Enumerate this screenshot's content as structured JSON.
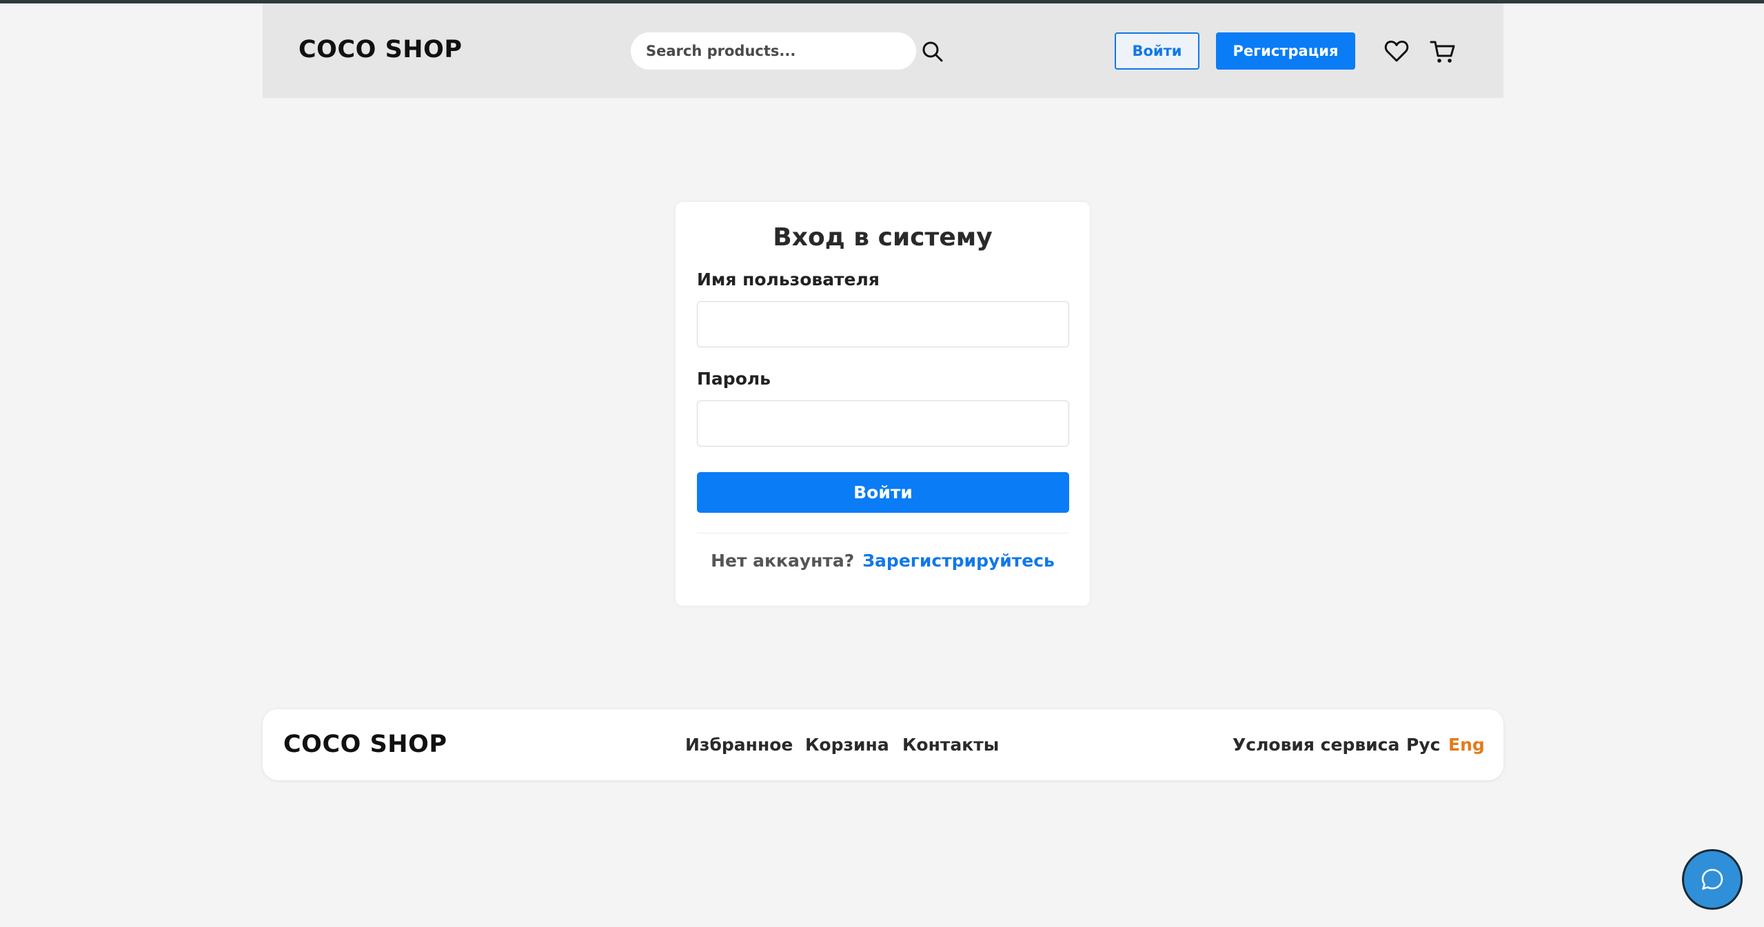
{
  "header": {
    "logo": "COCO SHOP",
    "search_placeholder": "Search products...",
    "login_label": "Войти",
    "register_label": "Регистрация",
    "icons": [
      "search-icon",
      "heart-icon",
      "cart-icon"
    ]
  },
  "login_form": {
    "title": "Вход в систему",
    "username_label": "Имя пользователя",
    "username_value": "",
    "password_label": "Пароль",
    "password_value": "",
    "submit_label": "Войти",
    "no_account_text": "Нет аккаунта?",
    "register_link": "Зарегистрируйтесь"
  },
  "footer": {
    "logo": "COCO SHOP",
    "links": [
      "Избранное",
      "Корзина",
      "Контакты"
    ],
    "terms": "Условия сервиса",
    "lang_ru": "Рус",
    "lang_en": "Eng"
  },
  "chat": {
    "icon": "chat-bubble-icon"
  },
  "colors": {
    "primary": "#0a7cf6",
    "accent_lang": "#e37b1c",
    "header_bg": "#e6e6e6",
    "page_bg": "#f4f4f4"
  }
}
